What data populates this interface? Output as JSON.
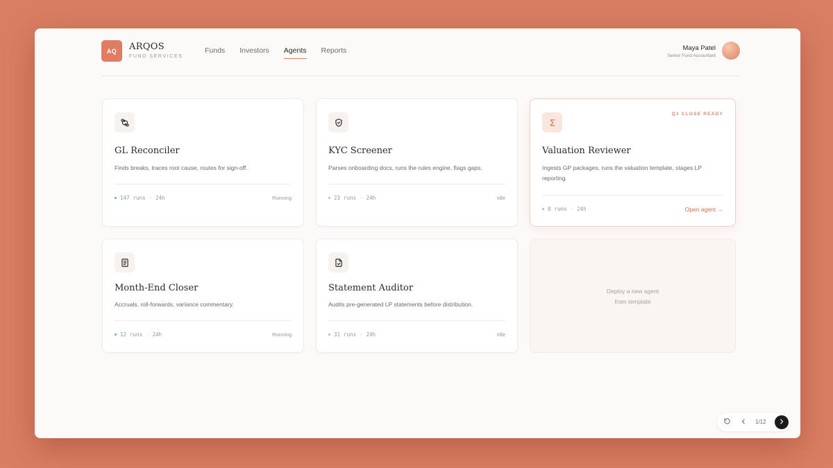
{
  "brand": {
    "logo_text": "AQ",
    "name": "ARQOS",
    "subtitle": "FUND SERVICES"
  },
  "nav": [
    {
      "label": "Funds",
      "active": false
    },
    {
      "label": "Investors",
      "active": false
    },
    {
      "label": "Agents",
      "active": true
    },
    {
      "label": "Reports",
      "active": false
    }
  ],
  "user": {
    "name": "Maya Patel",
    "role": "Senior Fund Accountant"
  },
  "cards": [
    {
      "title": "GL Reconciler",
      "icon": "git-compare-icon",
      "description": "Finds breaks, traces root cause, routes for sign-off.",
      "runs": "147",
      "runs_unit": "runs",
      "window": "24h",
      "status": "Running",
      "status_color": "#5fb98f"
    },
    {
      "title": "KYC Screener",
      "icon": "shield-check-icon",
      "description": "Parses onboarding docs, runs the rules engine, flags gaps.",
      "runs": "23",
      "runs_unit": "runs",
      "window": "24h",
      "status": "Idle",
      "status_color": "#bcb5b0"
    },
    {
      "title": "Valuation Reviewer",
      "icon": "sigma-icon",
      "badge": "Q1 CLOSE READY",
      "description": "Ingests GP packages, runs the valuation template, stages LP reporting.",
      "runs": "8",
      "runs_unit": "runs",
      "window": "24h",
      "action": "Open agent →",
      "status_color": "#bcb5b0"
    },
    {
      "title": "Month-End Closer",
      "icon": "document-list-icon",
      "description": "Accruals, roll-forwards, variance commentary.",
      "runs": "12",
      "runs_unit": "runs",
      "window": "24h",
      "status": "Running",
      "status_color": "#5fb98f"
    },
    {
      "title": "Statement Auditor",
      "icon": "file-check-icon",
      "description": "Audits pre-generated LP statements before distribution.",
      "runs": "31",
      "runs_unit": "runs",
      "window": "24h",
      "status": "Idle",
      "status_color": "#bcb5b0"
    }
  ],
  "deploy": {
    "line1": "Deploy a new agent",
    "line2": "from template"
  },
  "pager": {
    "count": "1/12"
  },
  "colors": {
    "accent": "#e07c61",
    "background": "#d97e63",
    "running": "#5fb98f"
  }
}
